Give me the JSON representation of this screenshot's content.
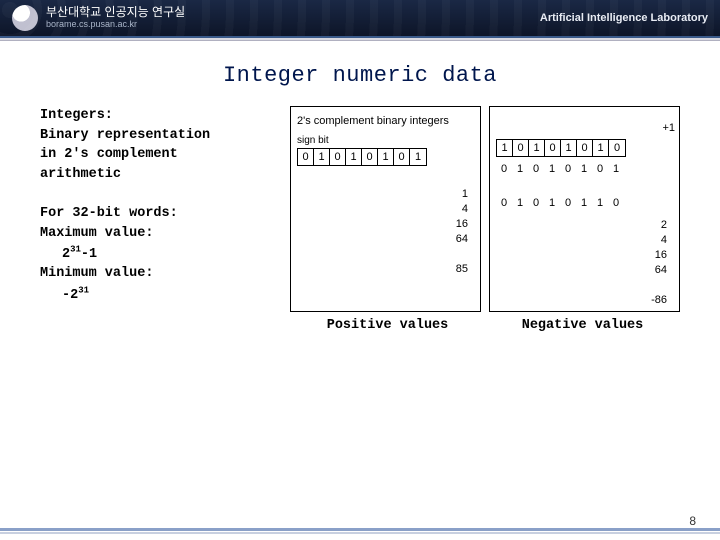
{
  "header": {
    "uni_kr": "부산대학교 인공지능 연구실",
    "uni_en": "borame.cs.pusan.ac.kr",
    "lab": "Artificial Intelligence Laboratory"
  },
  "title": "Integer numeric data",
  "text": {
    "integers_label": "Integers:",
    "line1": "Binary representation",
    "line2": "in 2's complement",
    "line3": "arithmetic",
    "for32": "For 32-bit words:",
    "maxlabel": "Maximum value:",
    "maxval_base": "2",
    "maxval_exp": "31",
    "maxval_suffix": "-1",
    "minlabel": "Minimum value:",
    "minval_prefix": "-2",
    "minval_exp": "31"
  },
  "diagram_positive": {
    "title": "2's complement binary integers",
    "sign_label": "sign bit",
    "bits": [
      "0",
      "1",
      "0",
      "1",
      "0",
      "1",
      "0",
      "1"
    ],
    "values": [
      "1",
      "4",
      "16",
      "64",
      "",
      "85"
    ]
  },
  "diagram_negative": {
    "bits_row1": [
      "1",
      "0",
      "1",
      "0",
      "1",
      "0",
      "1",
      "0"
    ],
    "bits_row2": [
      "0",
      "1",
      "0",
      "1",
      "0",
      "1",
      "0",
      "1"
    ],
    "plus1": "+1",
    "bits_row3": [
      "0",
      "1",
      "0",
      "1",
      "0",
      "1",
      "1",
      "0"
    ],
    "values": [
      "2",
      "4",
      "16",
      "64",
      "",
      "-86"
    ]
  },
  "captions": {
    "pos": "Positive values",
    "neg": "Negative values"
  },
  "page": "8"
}
